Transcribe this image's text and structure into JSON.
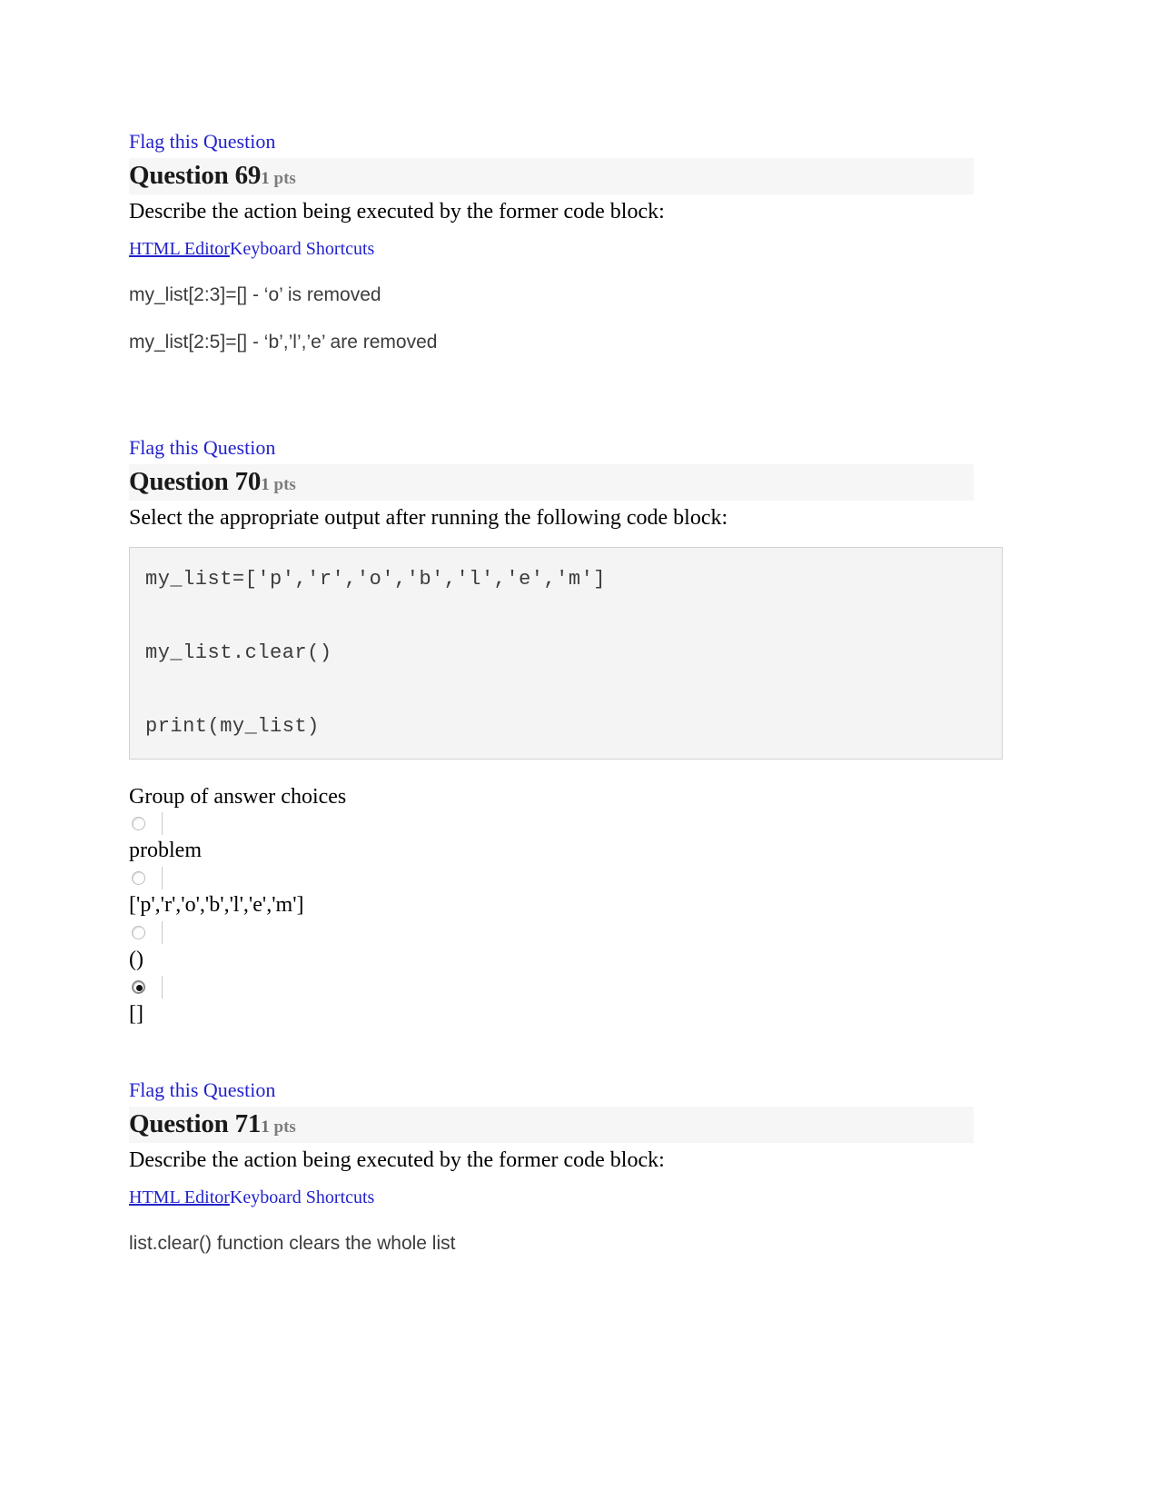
{
  "page": {
    "accent_link_color": "#2222cc",
    "header_band_color": "#f6f6f6",
    "code_block_bg": "#f4f4f4",
    "code_block_border": "#d2d2d2"
  },
  "questions": [
    {
      "flag_label": "Flag this Question",
      "title": "Question 69",
      "points": "1",
      "points_unit": "pts",
      "prompt": "Describe the action being executed by the former code block:",
      "editor": {
        "html_editor_label": "HTML Editor",
        "keyboard_shortcuts_label": "Keyboard Shortcuts"
      },
      "answer_lines": [
        "my_list[2:3]=[] - ‘o’ is removed",
        "my_list[2:5]=[] - ‘b’,’l’,’e’ are removed"
      ]
    },
    {
      "flag_label": "Flag this Question",
      "title": "Question 70",
      "points": "1",
      "points_unit": "pts",
      "prompt": "Select the appropriate output after running the following code block:",
      "code_lines": [
        "my_list=['p','r','o','b','l','e','m']",
        "my_list.clear()",
        "print(my_list)"
      ],
      "choices_label": "Group of answer choices",
      "choices": [
        {
          "text": "problem",
          "selected": false
        },
        {
          "text": "['p','r','o','b','l','e','m']",
          "selected": false
        },
        {
          "text": "()",
          "selected": false
        },
        {
          "text": "[]",
          "selected": true
        }
      ]
    },
    {
      "flag_label": "Flag this Question",
      "title": "Question 71",
      "points": "1",
      "points_unit": "pts",
      "prompt": "Describe the action being executed by the former code block:",
      "editor": {
        "html_editor_label": "HTML Editor",
        "keyboard_shortcuts_label": "Keyboard Shortcuts"
      },
      "answer_lines": [
        "list.clear() function clears the whole list"
      ]
    }
  ]
}
